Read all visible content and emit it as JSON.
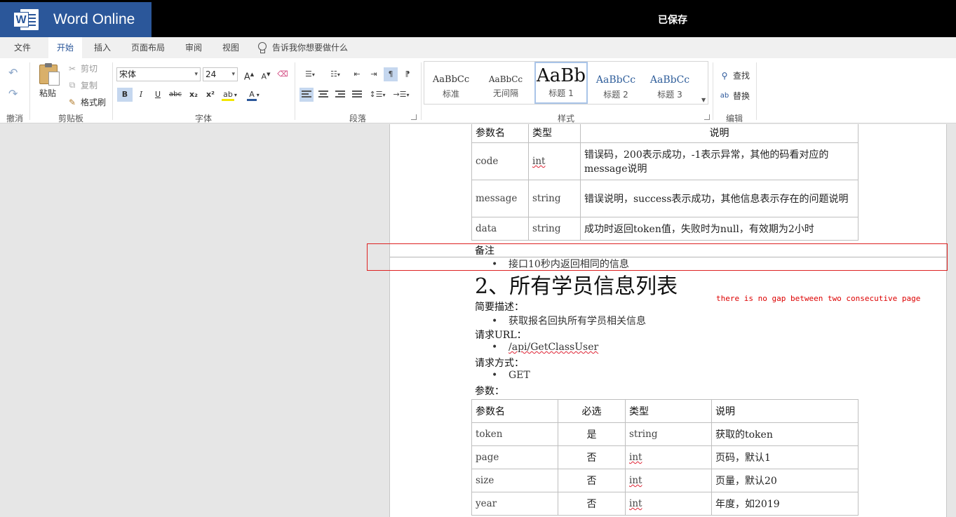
{
  "app": {
    "brand": "Word Online",
    "save_status": "已保存"
  },
  "tabs": [
    "文件",
    "开始",
    "插入",
    "页面布局",
    "审阅",
    "视图"
  ],
  "tell_me": "告诉我你想要做什么",
  "ribbon": {
    "groups": {
      "undo": "撤消",
      "clipboard": "剪贴板",
      "font": "字体",
      "paragraph": "段落",
      "styles": "样式",
      "editing": "编辑"
    },
    "clipboard": {
      "paste": "粘贴",
      "cut": "剪切",
      "copy": "复制",
      "format_painter": "格式刷"
    },
    "font": {
      "name": "宋体",
      "size": "24",
      "bold": "B",
      "italic": "I",
      "underline": "U",
      "strike": "abc",
      "subscript": "x₂",
      "superscript": "x²"
    },
    "styles": [
      {
        "preview": "AaBbCc",
        "name": "标准"
      },
      {
        "preview": "AaBbCc",
        "name": "无间隔"
      },
      {
        "preview": "AaBb",
        "name": "标题 1"
      },
      {
        "preview": "AaBbCc",
        "name": "标题 2"
      },
      {
        "preview": "AaBbCc",
        "name": "标题 3"
      }
    ],
    "editing": {
      "find": "查找",
      "replace": "替换"
    }
  },
  "document": {
    "table1": {
      "headers": [
        "参数名",
        "类型",
        "说明"
      ],
      "rows": [
        [
          "code",
          "int",
          "错误码，200表示成功，-1表示异常，其他的码看对应的message说明"
        ],
        [
          "message",
          "string",
          "错误说明，success表示成功，其他信息表示存在的问题说明"
        ],
        [
          "data",
          "string",
          "成功时返回token值，失败时为null，有效期为2小时"
        ]
      ]
    },
    "remark_label": "备注",
    "remark_item": "接口10秒内返回相同的信息",
    "section_heading": "2、所有学员信息列表",
    "brief_label": "简要描述：",
    "brief_item": "获取报名回执所有学员相关信息",
    "url_label": "请求URL：",
    "url_item": "/api/GetClassUser",
    "method_label": "请求方式：",
    "method_item": "GET",
    "params_label": "参数：",
    "table2": {
      "headers": [
        "参数名",
        "必选",
        "类型",
        "说明"
      ],
      "rows": [
        [
          "token",
          "是",
          "string",
          "获取的token"
        ],
        [
          "page",
          "否",
          "int",
          "页码，默认1"
        ],
        [
          "size",
          "否",
          "int",
          "页量，默认20"
        ],
        [
          "year",
          "否",
          "int",
          "年度，如2019"
        ]
      ]
    }
  },
  "annotation": "there is no gap between two consecutive page"
}
